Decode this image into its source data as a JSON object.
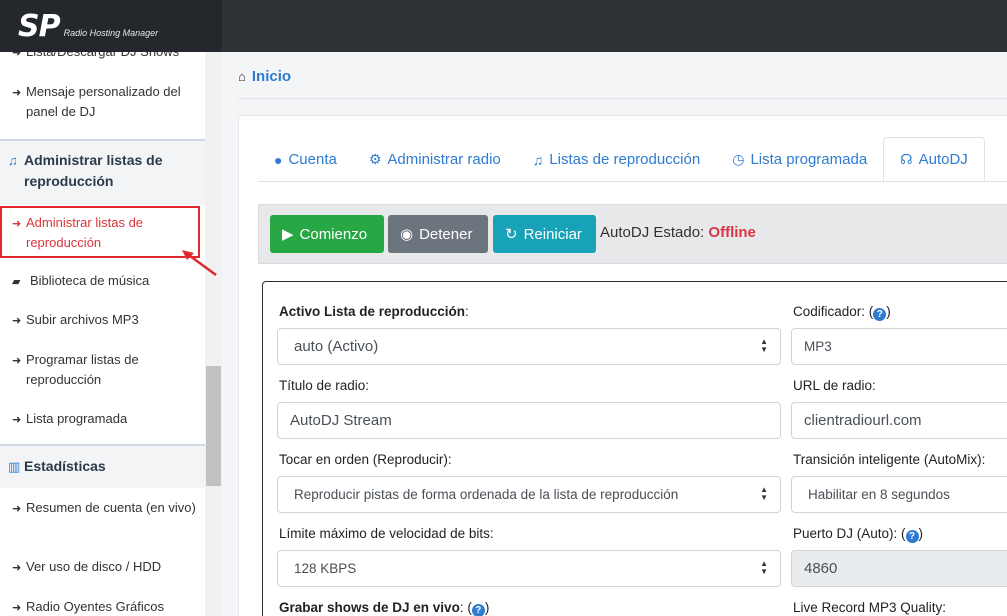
{
  "app": {
    "logo": "SP",
    "logo_subtitle": "Radio Hosting Manager"
  },
  "sidebar": {
    "items": [
      {
        "label": "Lista/Descargar DJ Shows",
        "icon": "circle-chevron-right-icon"
      },
      {
        "label": "Mensaje personalizado del panel de DJ",
        "icon": "circle-chevron-right-icon"
      }
    ],
    "section_playlists": {
      "label": "Administrar listas de reproducción",
      "icon": "music-icon"
    },
    "playlist_items": [
      {
        "label": "Administrar listas de reproducción",
        "icon": "circle-chevron-right-icon",
        "active": true
      },
      {
        "label": "Biblioteca de música",
        "icon": "folder-open-icon"
      },
      {
        "label": "Subir archivos MP3",
        "icon": "circle-chevron-right-icon"
      },
      {
        "label": "Programar listas de reproducción",
        "icon": "circle-chevron-right-icon"
      },
      {
        "label": "Lista programada",
        "icon": "circle-chevron-right-icon"
      }
    ],
    "section_stats": {
      "label": "Estadísticas",
      "icon": "bar-chart-icon"
    },
    "stats_items": [
      {
        "label": "Resumen de cuenta (en vivo)",
        "icon": "circle-chevron-right-icon"
      },
      {
        "label": "Ver uso de disco / HDD",
        "icon": "circle-chevron-right-icon"
      },
      {
        "label": "Radio Oyentes Gráficos",
        "icon": "circle-chevron-right-icon"
      }
    ]
  },
  "breadcrumb": {
    "label": "Inicio",
    "icon": "home-icon"
  },
  "tabs": [
    {
      "label": "Cuenta",
      "icon": "user-circle-icon"
    },
    {
      "label": "Administrar radio",
      "icon": "gear-icon"
    },
    {
      "label": "Listas de reproducción",
      "icon": "music-icon"
    },
    {
      "label": "Lista programada",
      "icon": "clock-icon"
    },
    {
      "label": "AutoDJ",
      "icon": "headphones-icon",
      "active": true
    }
  ],
  "toolbar": {
    "start_label": "Comienzo",
    "stop_label": "Detener",
    "restart_label": "Reiniciar",
    "status_label": "AutoDJ Estado:",
    "status_value": "Offline",
    "status_color": "#dc3545"
  },
  "form": {
    "active_playlist": {
      "label_bold": "Activo Lista de reproducción",
      "label_suffix": ":",
      "value": "auto (Activo)"
    },
    "encoder": {
      "label": "Codificador: (",
      "label_end": ")",
      "value": "MP3"
    },
    "radio_title": {
      "label": "Título de radio:",
      "value": "AutoDJ Stream"
    },
    "radio_url": {
      "label": "URL de radio:",
      "value": "clientradiourl.com"
    },
    "play_order": {
      "label": "Tocar en orden (Reproducir):",
      "value": "Reproducir pistas de forma ordenada de la lista de reproducción"
    },
    "smart_transition": {
      "label": "Transición inteligente (AutoMix):",
      "value": "Habilitar en 8 segundos"
    },
    "bitrate": {
      "label": "Límite máximo de velocidad de bits:",
      "value": "128 KBPS"
    },
    "dj_port": {
      "label": "Puerto DJ (Auto): (",
      "label_end": ")",
      "value": "4860"
    },
    "record_shows": {
      "label_bold": "Grabar shows de DJ en vivo",
      "label_suffix": ": (",
      "label_end": ")"
    },
    "live_record_quality": {
      "label": "Live Record MP3 Quality:"
    }
  },
  "colors": {
    "accent": "#2e7bcf",
    "start": "#28a745",
    "stop": "#6c757d",
    "restart": "#17a2b8",
    "active_outline": "#e0282e"
  }
}
